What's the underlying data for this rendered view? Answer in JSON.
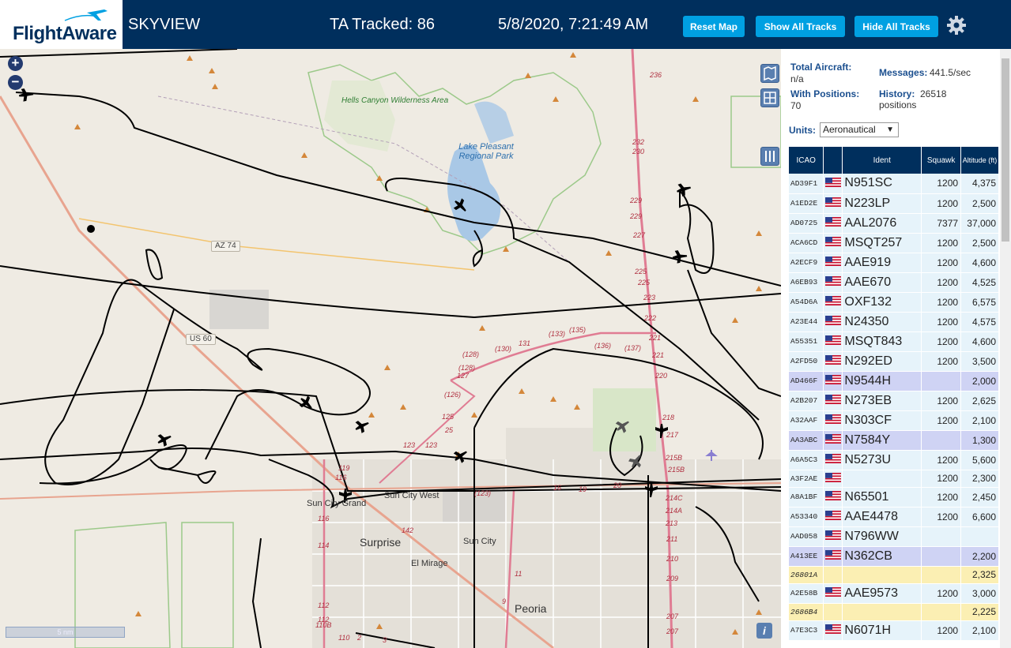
{
  "header": {
    "logo_text": "FlightAware",
    "app_name": "SKYVIEW",
    "tracked": "TA Tracked: 86",
    "datetime": "5/8/2020, 7:21:49 AM",
    "reset_map": "Reset Map",
    "show_all": "Show All Tracks",
    "hide_all": "Hide All Tracks",
    "colors": {
      "bar": "#002f5d",
      "button": "#00a0e2"
    }
  },
  "map": {
    "zoom_in": "+",
    "zoom_out": "−",
    "scale": "5 nm",
    "info": "i",
    "labels": {
      "hells_canyon": "Hells Canyon Wilderness Area",
      "lake_pleasant": "Lake Pleasant Regional Park",
      "az74": "AZ 74",
      "us60": "US 60",
      "sun_city_grand": "Sun City Grand",
      "sun_city_west": "Sun City West",
      "surprise": "Surprise",
      "sun_city": "Sun City",
      "el_mirage": "El Mirage",
      "peoria": "Peoria"
    },
    "routes": [
      "236",
      "232",
      "230",
      "229",
      "229",
      "227",
      "225",
      "225",
      "223",
      "222",
      "221",
      "221",
      "220",
      "218",
      "217",
      "215B",
      "215B",
      "214C",
      "214A",
      "213",
      "211",
      "210",
      "209",
      "207",
      "207",
      "(128)",
      "(128)",
      "127",
      "(126)",
      "125",
      "25",
      "(130)",
      "131",
      "(133)",
      "(135)",
      "(136)",
      "(137)",
      "123",
      "123",
      "119",
      "116",
      "116",
      "114",
      "112",
      "112",
      "110B",
      "110",
      "142",
      "16",
      "11",
      "9",
      "(123)",
      "19",
      "20",
      "2",
      "3"
    ]
  },
  "panel": {
    "total_aircraft_label": "Total Aircraft:",
    "total_aircraft_value": "n/a",
    "with_positions_label": "With Positions:",
    "with_positions_value": "70",
    "messages_label": "Messages:",
    "messages_value": "441.5/sec",
    "history_label": "History:",
    "history_value": "26518 positions",
    "units_label": "Units:",
    "units_value": "Aeronautical",
    "columns": {
      "icao": "ICAO",
      "ident": "Ident",
      "squawk": "Squawk",
      "altitude": "Altitude (ft)"
    },
    "rows": [
      {
        "icao": "AD39F1",
        "flag": true,
        "ident": "N951SC",
        "squawk": "1200",
        "alt": "4,375",
        "style": "norm"
      },
      {
        "icao": "A1ED2E",
        "flag": true,
        "ident": "N223LP",
        "squawk": "1200",
        "alt": "2,500",
        "style": "norm"
      },
      {
        "icao": "AD0725",
        "flag": true,
        "ident": "AAL2076",
        "squawk": "7377",
        "alt": "37,000",
        "style": "norm"
      },
      {
        "icao": "ACA6CD",
        "flag": true,
        "ident": "MSQT257",
        "squawk": "1200",
        "alt": "2,500",
        "style": "norm"
      },
      {
        "icao": "A2ECF9",
        "flag": true,
        "ident": "AAE919",
        "squawk": "1200",
        "alt": "4,600",
        "style": "norm"
      },
      {
        "icao": "A6EB93",
        "flag": true,
        "ident": "AAE670",
        "squawk": "1200",
        "alt": "4,525",
        "style": "norm"
      },
      {
        "icao": "A54D6A",
        "flag": true,
        "ident": "OXF132",
        "squawk": "1200",
        "alt": "6,575",
        "style": "norm"
      },
      {
        "icao": "A23E44",
        "flag": true,
        "ident": "N24350",
        "squawk": "1200",
        "alt": "4,575",
        "style": "norm"
      },
      {
        "icao": "A55351",
        "flag": true,
        "ident": "MSQT843",
        "squawk": "1200",
        "alt": "4,600",
        "style": "norm"
      },
      {
        "icao": "A2FD50",
        "flag": true,
        "ident": "N292ED",
        "squawk": "1200",
        "alt": "3,500",
        "style": "norm"
      },
      {
        "icao": "AD466F",
        "flag": true,
        "ident": "N9544H",
        "squawk": "",
        "alt": "2,000",
        "style": "sel"
      },
      {
        "icao": "A2B207",
        "flag": true,
        "ident": "N273EB",
        "squawk": "1200",
        "alt": "2,625",
        "style": "norm"
      },
      {
        "icao": "A32AAF",
        "flag": true,
        "ident": "N303CF",
        "squawk": "1200",
        "alt": "2,100",
        "style": "norm"
      },
      {
        "icao": "AA3ABC",
        "flag": true,
        "ident": "N7584Y",
        "squawk": "",
        "alt": "1,300",
        "style": "sel"
      },
      {
        "icao": "A6A5C3",
        "flag": true,
        "ident": "N5273U",
        "squawk": "1200",
        "alt": "5,600",
        "style": "norm"
      },
      {
        "icao": "A3F2AE",
        "flag": true,
        "ident": "",
        "squawk": "1200",
        "alt": "2,300",
        "style": "norm short"
      },
      {
        "icao": "A8A1BF",
        "flag": true,
        "ident": "N65501",
        "squawk": "1200",
        "alt": "2,450",
        "style": "norm"
      },
      {
        "icao": "A53340",
        "flag": true,
        "ident": "AAE4478",
        "squawk": "1200",
        "alt": "6,600",
        "style": "norm"
      },
      {
        "icao": "AAD058",
        "flag": true,
        "ident": "N796WW",
        "squawk": "",
        "alt": "",
        "style": "norm"
      },
      {
        "icao": "A413EE",
        "flag": true,
        "ident": "N362CB",
        "squawk": "",
        "alt": "2,200",
        "style": "sel"
      },
      {
        "icao": "26801A",
        "flag": false,
        "ident": "",
        "squawk": "",
        "alt": "2,325",
        "style": "tisb"
      },
      {
        "icao": "A2E58B",
        "flag": true,
        "ident": "AAE9573",
        "squawk": "1200",
        "alt": "3,000",
        "style": "norm"
      },
      {
        "icao": "2686B4",
        "flag": false,
        "ident": "",
        "squawk": "",
        "alt": "2,225",
        "style": "tisb"
      },
      {
        "icao": "A7E3C3",
        "flag": true,
        "ident": "N6071H",
        "squawk": "1200",
        "alt": "2,100",
        "style": "norm"
      }
    ]
  }
}
